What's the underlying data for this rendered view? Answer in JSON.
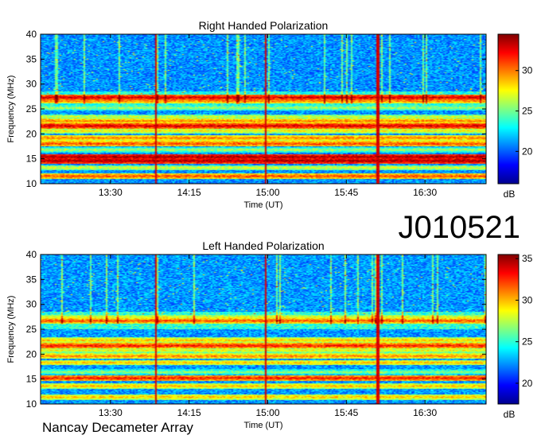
{
  "observation_code": "J010521",
  "credit": "Nancay Decameter Array",
  "colors": {
    "colormap": [
      "#00008f",
      "#0000ff",
      "#0080ff",
      "#00ffff",
      "#80ff80",
      "#ffff00",
      "#ff8000",
      "#ff0000",
      "#800000"
    ]
  },
  "chart_data": [
    {
      "type": "heatmap",
      "title": "Right Handed Polarization",
      "xlabel": "Time (UT)",
      "ylabel": "Frequency (MHz)",
      "x_ticks": [
        "13:30",
        "14:15",
        "15:00",
        "15:45",
        "16:30"
      ],
      "x_tick_minutes": [
        810,
        855,
        900,
        945,
        990
      ],
      "xlim_minutes": [
        770,
        1025
      ],
      "y_ticks": [
        10,
        15,
        20,
        25,
        30,
        35,
        40
      ],
      "ylim": [
        10,
        40
      ],
      "colorbar": {
        "label": "dB",
        "range": [
          16,
          34.5
        ],
        "ticks": [
          20,
          25,
          30
        ]
      },
      "persistent_bands_mhz": [
        {
          "freq": 11.5,
          "level": 31
        },
        {
          "freq": 13.2,
          "level": 27
        },
        {
          "freq": 14.6,
          "level": 34
        },
        {
          "freq": 15.4,
          "level": 34
        },
        {
          "freq": 16.8,
          "level": 26
        },
        {
          "freq": 18.0,
          "level": 31
        },
        {
          "freq": 19.2,
          "level": 30
        },
        {
          "freq": 20.6,
          "level": 28
        },
        {
          "freq": 21.6,
          "level": 33
        },
        {
          "freq": 22.6,
          "level": 30
        },
        {
          "freq": 23.4,
          "level": 27
        },
        {
          "freq": 25.2,
          "level": 26
        },
        {
          "freq": 26.6,
          "level": 30
        },
        {
          "freq": 27.3,
          "level": 33
        }
      ],
      "vertical_spikes_minutes": [
        836,
        899,
        963
      ]
    },
    {
      "type": "heatmap",
      "title": "Left Handed Polarization",
      "xlabel": "Time (UT)",
      "ylabel": "Frequency (MHz)",
      "x_ticks": [
        "13:30",
        "14:15",
        "15:00",
        "15:45",
        "16:30"
      ],
      "x_tick_minutes": [
        810,
        855,
        900,
        945,
        990
      ],
      "xlim_minutes": [
        770,
        1025
      ],
      "y_ticks": [
        10,
        15,
        20,
        25,
        30,
        35,
        40
      ],
      "ylim": [
        10,
        40
      ],
      "colorbar": {
        "label": "dB",
        "range": [
          17.5,
          35.5
        ],
        "ticks": [
          20,
          25,
          30,
          35
        ]
      },
      "persistent_bands_mhz": [
        {
          "freq": 11.4,
          "level": 30
        },
        {
          "freq": 13.6,
          "level": 30
        },
        {
          "freq": 15.2,
          "level": 33
        },
        {
          "freq": 16.4,
          "level": 27
        },
        {
          "freq": 18.3,
          "level": 30
        },
        {
          "freq": 19.6,
          "level": 31
        },
        {
          "freq": 20.8,
          "level": 29
        },
        {
          "freq": 21.7,
          "level": 33
        },
        {
          "freq": 22.8,
          "level": 30
        },
        {
          "freq": 26.7,
          "level": 32
        },
        {
          "freq": 27.4,
          "level": 29
        }
      ],
      "vertical_spikes_minutes": [
        836,
        899,
        963
      ]
    }
  ]
}
